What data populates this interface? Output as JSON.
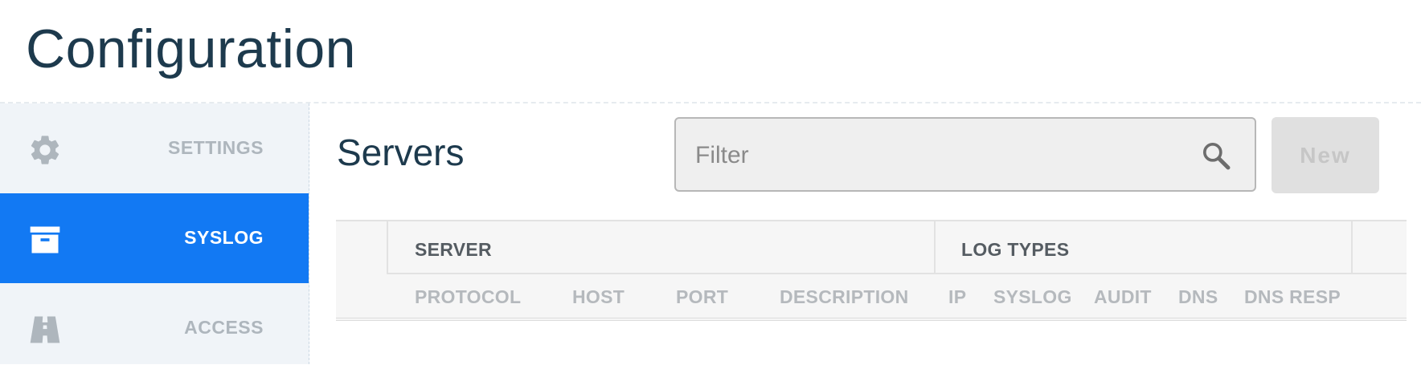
{
  "page": {
    "title": "Configuration"
  },
  "sidebar": {
    "items": [
      {
        "label": "SETTINGS",
        "icon": "gear-icon",
        "active": false
      },
      {
        "label": "SYSLOG",
        "icon": "archive-box-icon",
        "active": true
      },
      {
        "label": "ACCESS",
        "icon": "road-icon",
        "active": false
      }
    ]
  },
  "main": {
    "title": "Servers",
    "filter": {
      "placeholder": "Filter",
      "value": ""
    },
    "new_button": {
      "label": "New",
      "enabled": false
    },
    "table": {
      "groups": [
        {
          "label": "SERVER"
        },
        {
          "label": "LOG TYPES"
        }
      ],
      "columns": [
        "PROTOCOL",
        "HOST",
        "PORT",
        "DESCRIPTION",
        "IP",
        "SYSLOG",
        "AUDIT",
        "DNS",
        "DNS RESP"
      ],
      "rows": []
    }
  },
  "colors": {
    "accent": "#1279f3",
    "title": "#1d3a4d",
    "sidebar_bg": "#f0f4f8",
    "muted_label": "#aeb6bd"
  }
}
